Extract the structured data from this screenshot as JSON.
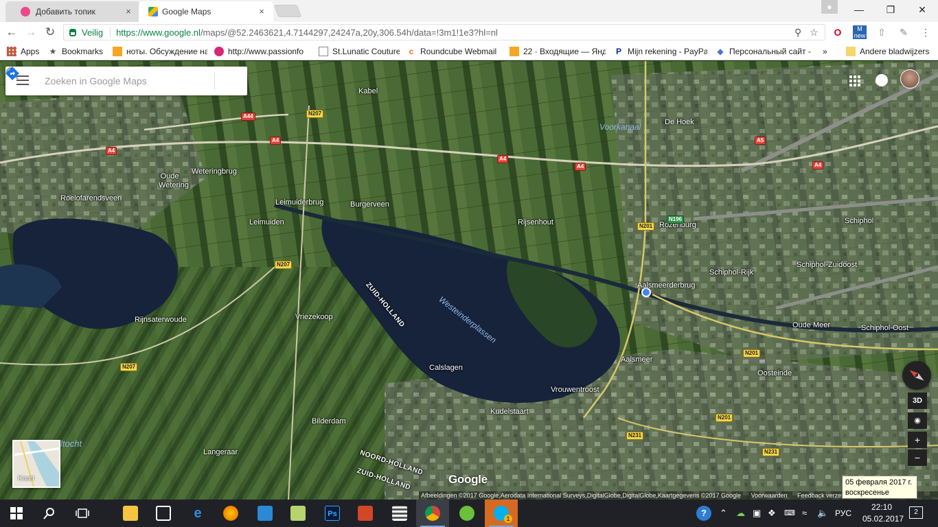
{
  "browser": {
    "tabs": [
      {
        "title": "Добавить топик",
        "active": false
      },
      {
        "title": "Google Maps",
        "active": true
      }
    ],
    "close_glyph": "×",
    "window_controls": {
      "minimize": "—",
      "maximize": "❐",
      "close": "✕"
    },
    "security_label": "Veilig",
    "url_host": "https://www.google.nl",
    "url_path": "/maps/@52.2463621,4.7144297,24247a,20y,306.54h/data=!3m1!1e3?hl=nl",
    "extension_badge": "new",
    "bookmarks": [
      {
        "label": "Apps",
        "icon": "apps-grid-icon"
      },
      {
        "label": "Bookmarks",
        "icon": "star-icon"
      },
      {
        "label": "ноты. Обсуждение на",
        "icon": "folder-icon"
      },
      {
        "label": "http://www.passionfo",
        "icon": "site-icon"
      },
      {
        "label": "St.Lunatic Couture",
        "icon": "page-icon"
      },
      {
        "label": "Roundcube Webmail",
        "icon": "cpanel-icon"
      },
      {
        "label": "22 · Входящие — Янд",
        "icon": "mail-icon"
      },
      {
        "label": "Mijn rekening - PayPa",
        "icon": "paypal-icon"
      },
      {
        "label": "Персональный сайт -",
        "icon": "shield-icon"
      }
    ],
    "bookmarks_overflow": "»",
    "other_bookmarks": "Andere bladwijzers"
  },
  "map": {
    "search_placeholder": "Zoeken in Google Maps",
    "layer_label": "Kaart",
    "tilt_label": "3D",
    "zoom_in": "+",
    "zoom_out": "−",
    "logo": "Google",
    "attribution": "Afbeeldingen ©2017 Google,Aerodata International Surveys,DigitalGlobe,DigitalGlobe,Kaartgegevens ©2017 Google",
    "terms": "Voorwaarden",
    "feedback": "Feedback verzenden",
    "places": [
      {
        "name": "Kabel",
        "kind": "town"
      },
      {
        "name": "De Hoek",
        "kind": "town"
      },
      {
        "name": "Voorkanaal",
        "kind": "water"
      },
      {
        "name": "Weteringbrug",
        "kind": "town"
      },
      {
        "name": "Oude Wetering",
        "kind": "town"
      },
      {
        "name": "Roelofarendsveen",
        "kind": "town"
      },
      {
        "name": "Leimuiderbrug",
        "kind": "town"
      },
      {
        "name": "Burgerveen",
        "kind": "town"
      },
      {
        "name": "Leimuiden",
        "kind": "town"
      },
      {
        "name": "Rijsenhout",
        "kind": "town"
      },
      {
        "name": "Rozenburg",
        "kind": "town"
      },
      {
        "name": "Schiphol",
        "kind": "town"
      },
      {
        "name": "Schiphol-Zuidoost",
        "kind": "town"
      },
      {
        "name": "Schiphol-Rijk",
        "kind": "town"
      },
      {
        "name": "Aalsmeerderbrug",
        "kind": "town"
      },
      {
        "name": "Westeinderplassen",
        "kind": "water"
      },
      {
        "name": "ZUID-HOLLAND",
        "kind": "region"
      },
      {
        "name": "Rijnsaterwoude",
        "kind": "town"
      },
      {
        "name": "Vriezekoop",
        "kind": "town"
      },
      {
        "name": "Oude Meer",
        "kind": "town"
      },
      {
        "name": "Schiphol-Oost",
        "kind": "town"
      },
      {
        "name": "Aalsmeer",
        "kind": "town"
      },
      {
        "name": "Calslagen",
        "kind": "town"
      },
      {
        "name": "Oosteinde",
        "kind": "town"
      },
      {
        "name": "Vrouwentroost",
        "kind": "town"
      },
      {
        "name": "Kudelstaart",
        "kind": "town"
      },
      {
        "name": "Bilderdam",
        "kind": "town"
      },
      {
        "name": "Langeraar",
        "kind": "town"
      },
      {
        "name": "NOORD-HOLLAND",
        "kind": "region"
      },
      {
        "name": "ZUID-HOLLAND",
        "kind": "region"
      },
      {
        "name": "ltocht",
        "kind": "water"
      }
    ],
    "road_shields": [
      {
        "label": "N207",
        "color": "yellow"
      },
      {
        "label": "A44",
        "color": "red"
      },
      {
        "label": "A4",
        "color": "red"
      },
      {
        "label": "A4",
        "color": "red"
      },
      {
        "label": "A4",
        "color": "red"
      },
      {
        "label": "A5",
        "color": "red"
      },
      {
        "label": "A4",
        "color": "red"
      },
      {
        "label": "N196",
        "color": "green"
      },
      {
        "label": "N201",
        "color": "yellow"
      },
      {
        "label": "N207",
        "color": "yellow"
      },
      {
        "label": "N207",
        "color": "yellow"
      },
      {
        "label": "N201",
        "color": "yellow"
      },
      {
        "label": "N201",
        "color": "yellow"
      },
      {
        "label": "N231",
        "color": "yellow"
      },
      {
        "label": "N231",
        "color": "yellow"
      }
    ]
  },
  "tooltip": {
    "line1": "05 февраля 2017 г.",
    "line2": "воскресенье"
  },
  "taskbar": {
    "apps": [
      "start-icon",
      "search-icon",
      "task-view-icon",
      "file-explorer-icon",
      "store-icon",
      "edge-icon",
      "firefox-icon",
      "control-panel-icon",
      "sticky-notes-icon",
      "photoshop-icon",
      "powerpoint-icon",
      "calculator-icon",
      "chrome-icon",
      "utorrent-icon",
      "skype-icon"
    ],
    "ps_label": "Ps",
    "skype_badge": "1",
    "language": "РУС",
    "time": "22:10",
    "date": "05.02.2017",
    "notifications": "2"
  },
  "colors": {
    "accent": "#1a73e8",
    "secure_green": "#0b8043",
    "map_water": "#16233a",
    "map_land": "#3c5a2e"
  }
}
